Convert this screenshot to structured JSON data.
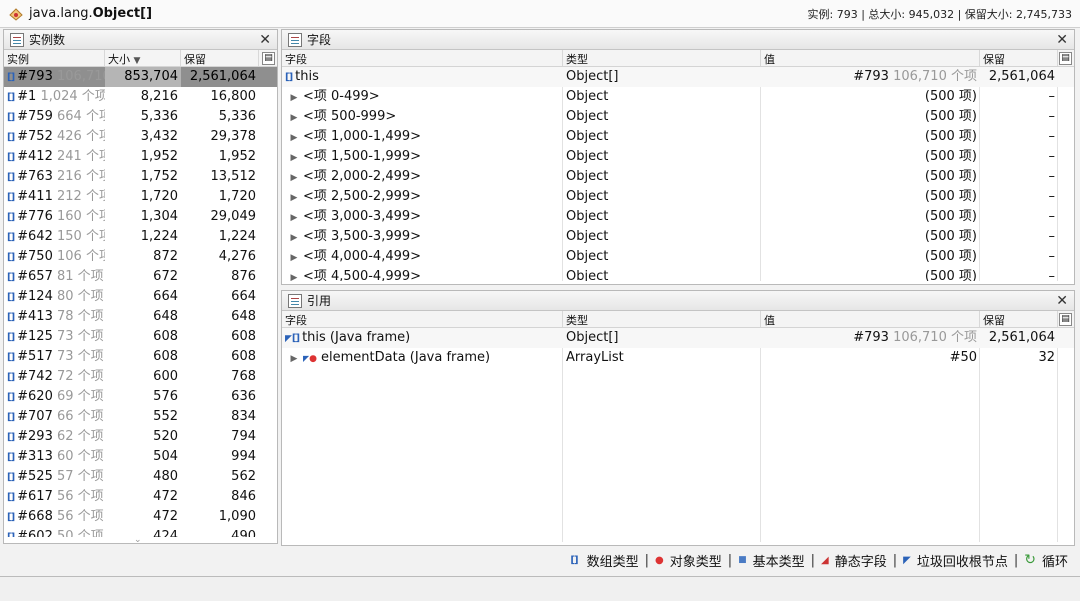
{
  "title": {
    "prefix": "java.lang.",
    "classname": "Object[]",
    "stats": "实例: 793 | 总大小: 945,032 | 保留大小: 2,745,733"
  },
  "instances": {
    "panel_title": "实例数",
    "headers": [
      "实例",
      "大小",
      "保留"
    ],
    "rows": [
      {
        "id": "#793",
        "count": "106,710 个项",
        "size": "853,704",
        "retained": "2,561,064"
      },
      {
        "id": "#1",
        "count": "1,024 个项",
        "size": "8,216",
        "retained": "16,800"
      },
      {
        "id": "#759",
        "count": "664 个项",
        "size": "5,336",
        "retained": "5,336"
      },
      {
        "id": "#752",
        "count": "426 个项",
        "size": "3,432",
        "retained": "29,378"
      },
      {
        "id": "#412",
        "count": "241 个项",
        "size": "1,952",
        "retained": "1,952"
      },
      {
        "id": "#763",
        "count": "216 个项",
        "size": "1,752",
        "retained": "13,512"
      },
      {
        "id": "#411",
        "count": "212 个项",
        "size": "1,720",
        "retained": "1,720"
      },
      {
        "id": "#776",
        "count": "160 个项",
        "size": "1,304",
        "retained": "29,049"
      },
      {
        "id": "#642",
        "count": "150 个项",
        "size": "1,224",
        "retained": "1,224"
      },
      {
        "id": "#750",
        "count": "106 个项",
        "size": "872",
        "retained": "4,276"
      },
      {
        "id": "#657",
        "count": "81 个项",
        "size": "672",
        "retained": "876"
      },
      {
        "id": "#124",
        "count": "80 个项",
        "size": "664",
        "retained": "664"
      },
      {
        "id": "#413",
        "count": "78 个项",
        "size": "648",
        "retained": "648"
      },
      {
        "id": "#125",
        "count": "73 个项",
        "size": "608",
        "retained": "608"
      },
      {
        "id": "#517",
        "count": "73 个项",
        "size": "608",
        "retained": "608"
      },
      {
        "id": "#742",
        "count": "72 个项",
        "size": "600",
        "retained": "768"
      },
      {
        "id": "#620",
        "count": "69 个项",
        "size": "576",
        "retained": "636"
      },
      {
        "id": "#707",
        "count": "66 个项",
        "size": "552",
        "retained": "834"
      },
      {
        "id": "#293",
        "count": "62 个项",
        "size": "520",
        "retained": "794"
      },
      {
        "id": "#313",
        "count": "60 个项",
        "size": "504",
        "retained": "994"
      },
      {
        "id": "#525",
        "count": "57 个项",
        "size": "480",
        "retained": "562"
      },
      {
        "id": "#617",
        "count": "56 个项",
        "size": "472",
        "retained": "846"
      },
      {
        "id": "#668",
        "count": "56 个项",
        "size": "472",
        "retained": "1,090"
      },
      {
        "id": "#602",
        "count": "50 个项",
        "size": "424",
        "retained": "490"
      }
    ]
  },
  "fields": {
    "panel_title": "字段",
    "headers": [
      "字段",
      "类型",
      "值",
      "保留"
    ],
    "root": {
      "name": "this",
      "type": "Object[]",
      "value": "#793",
      "value_extra": "106,710 个项",
      "retained": "2,561,064"
    },
    "rows": [
      {
        "name": "<项 0-499>",
        "type": "Object",
        "value": "(500 项)",
        "retained": "–"
      },
      {
        "name": "<项 500-999>",
        "type": "Object",
        "value": "(500 项)",
        "retained": "–"
      },
      {
        "name": "<项 1,000-1,499>",
        "type": "Object",
        "value": "(500 项)",
        "retained": "–"
      },
      {
        "name": "<项 1,500-1,999>",
        "type": "Object",
        "value": "(500 项)",
        "retained": "–"
      },
      {
        "name": "<项 2,000-2,499>",
        "type": "Object",
        "value": "(500 项)",
        "retained": "–"
      },
      {
        "name": "<项 2,500-2,999>",
        "type": "Object",
        "value": "(500 项)",
        "retained": "–"
      },
      {
        "name": "<项 3,000-3,499>",
        "type": "Object",
        "value": "(500 项)",
        "retained": "–"
      },
      {
        "name": "<项 3,500-3,999>",
        "type": "Object",
        "value": "(500 项)",
        "retained": "–"
      },
      {
        "name": "<项 4,000-4,499>",
        "type": "Object",
        "value": "(500 项)",
        "retained": "–"
      },
      {
        "name": "<项 4,500-4,999>",
        "type": "Object",
        "value": "(500 项)",
        "retained": "–"
      }
    ]
  },
  "references": {
    "panel_title": "引用",
    "headers": [
      "字段",
      "类型",
      "值",
      "保留"
    ],
    "root": {
      "name": "this (Java frame)",
      "type": "Object[]",
      "value": "#793",
      "value_extra": "106,710 个项",
      "retained": "2,561,064"
    },
    "rows": [
      {
        "name": "elementData (Java frame)",
        "type": "ArrayList",
        "value": "#50",
        "retained": "32"
      }
    ]
  },
  "legend": [
    "数组类型",
    "对象类型",
    "基本类型",
    "静态字段",
    "垃圾回收根节点",
    "循环"
  ]
}
